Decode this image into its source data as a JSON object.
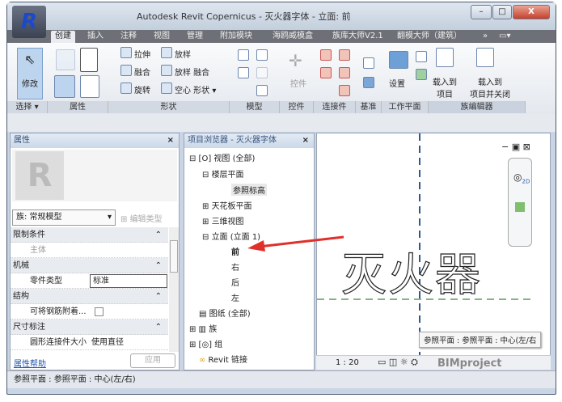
{
  "window": {
    "title": "Autodesk Revit Copernicus -    灭火器字体 - 立面: 前",
    "minimize": "–",
    "maximize": "□",
    "close": "X"
  },
  "tabs": [
    "创建",
    "插入",
    "注释",
    "视图",
    "管理",
    "附加模块",
    "海鸥威模盒",
    "族库大师V2.1",
    "翻模大师（建筑）",
    "»",
    "▭▾"
  ],
  "ribbon": {
    "modify": "修改",
    "shape": {
      "extrude": "拉伸",
      "sweep": "放样",
      "blend": "融合",
      "sweep_blend": "放样 融合",
      "revolve": "旋转",
      "void": "空心 形状 ▾"
    },
    "control": "控件",
    "setup": "设置",
    "load_project": [
      "载入到",
      "项目"
    ],
    "load_close": [
      "载入到",
      "项目并关闭"
    ],
    "panels": [
      "选择 ▾",
      "属性",
      "形状",
      "模型",
      "控件",
      "连接件",
      "基准",
      "工作平面",
      "族编辑器"
    ]
  },
  "properties": {
    "title": "属性",
    "close": "×",
    "family_select": "族: 常规模型",
    "edit_type": "编辑类型",
    "rows": [
      {
        "group": "限制条件"
      },
      {
        "name": "主体",
        "value": ""
      },
      {
        "group": "机械"
      },
      {
        "name": "零件类型",
        "value": "标准"
      },
      {
        "group": "结构"
      },
      {
        "name": "可将钢筋附着...",
        "value": ""
      },
      {
        "group": "尺寸标注"
      },
      {
        "name": "圆形连接件大小",
        "value": "使用直径"
      }
    ],
    "help": "属性帮助",
    "apply": "应用"
  },
  "browser": {
    "title": "项目浏览器 - 灭火器字体",
    "close": "×",
    "items": [
      "视图 (全部)",
      "楼层平面",
      "参照标高",
      "天花板平面",
      "三维视图",
      "立面 (立面 1)",
      "前",
      "右",
      "后",
      "左",
      "图纸 (全部)",
      "族",
      "组",
      "Revit 链接"
    ]
  },
  "view": {
    "text": "灭火器",
    "tooltip": "参照平面 : 参照平面 : 中心(左/右",
    "scale": "1 : 20",
    "watermark": "BIMproject",
    "nav_2d": "2D"
  },
  "status": "参照平面 : 参照平面 : 中心(左/右)",
  "colors": {
    "accent": "#1c49c9",
    "arrow": "#e0302a",
    "ref_plane": "#2b5a8c",
    "level": "#5f9a5f"
  }
}
